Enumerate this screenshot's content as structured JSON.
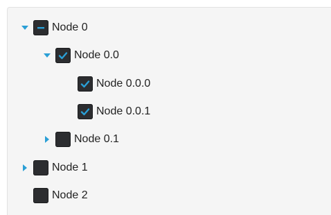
{
  "colors": {
    "accent": "#2a9fd6",
    "checkbox_bg": "#2c2d30",
    "panel_bg": "#f5f5f5",
    "text": "#222222"
  },
  "tree": {
    "nodes": [
      {
        "label": "Node 0",
        "state": "indeterminate",
        "expander": "expanded"
      },
      {
        "label": "Node 0.0",
        "state": "checked",
        "expander": "expanded"
      },
      {
        "label": "Node 0.0.0",
        "state": "checked",
        "expander": "none"
      },
      {
        "label": "Node 0.0.1",
        "state": "checked",
        "expander": "none"
      },
      {
        "label": "Node 0.1",
        "state": "unchecked",
        "expander": "collapsed"
      },
      {
        "label": "Node 1",
        "state": "unchecked",
        "expander": "collapsed"
      },
      {
        "label": "Node 2",
        "state": "unchecked",
        "expander": "none"
      }
    ]
  }
}
